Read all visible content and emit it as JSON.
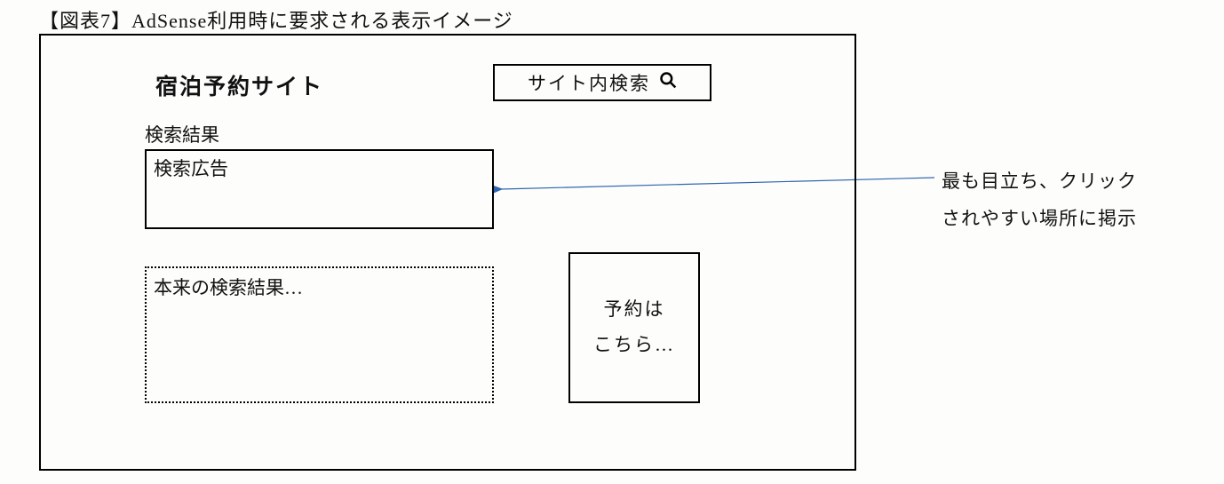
{
  "caption": "【図表7】AdSense利用時に要求される表示イメージ",
  "site_title": "宿泊予約サイト",
  "search_label": "サイト内検索",
  "results_label": "検索結果",
  "ad_box_label": "検索広告",
  "organic_box_label": "本来の検索結果…",
  "cta_box_label": "予約は\nこちら…",
  "annotation_line1": "最も目立ち、クリック",
  "annotation_line2": "されやすい場所に掲示"
}
